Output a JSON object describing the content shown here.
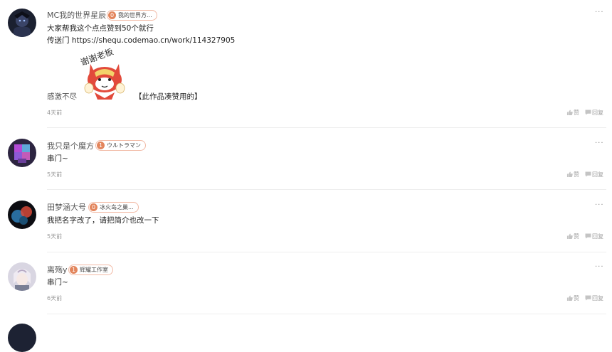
{
  "comments": [
    {
      "username": "MC我的世界星辰",
      "badge_level": "0",
      "badge_label": "我的世界方...",
      "lines": [
        "大家帮我这个点点赞到50个就行",
        "传送门 https://shequ.codemao.cn/work/114327905"
      ],
      "extra_left": "感激不尽",
      "extra_right": "【此作品凑赞用的】",
      "sticker_text": "谢谢老板",
      "time": "4天前",
      "like_label": "赞",
      "reply_label": "回复"
    },
    {
      "username": "我只是个魔方",
      "badge_level": "1",
      "badge_label": "ウルトラマン",
      "lines": [
        "串门~"
      ],
      "time": "5天前",
      "like_label": "赞",
      "reply_label": "回复"
    },
    {
      "username": "田梦涵大号",
      "badge_level": "0",
      "badge_label": "冰火岛之巢...",
      "lines": [
        "我把名字改了，请把简介也改一下"
      ],
      "time": "5天前",
      "like_label": "赞",
      "reply_label": "回复"
    },
    {
      "username": "离殇y",
      "badge_level": "1",
      "badge_label": "辉耀工作室",
      "lines": [
        "串门~"
      ],
      "time": "6天前",
      "like_label": "赞",
      "reply_label": "回复"
    }
  ],
  "more_label": "···",
  "colors": {
    "badge_border": "#f1b9a4",
    "badge_level_bg": "#e3855c",
    "divider": "#eeeeee"
  }
}
